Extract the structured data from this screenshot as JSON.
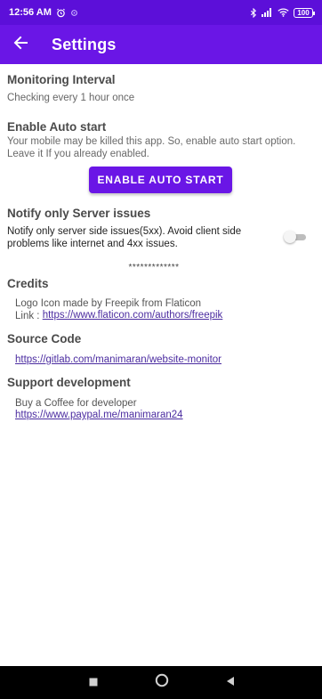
{
  "status_bar": {
    "time": "12:56 AM",
    "icons_left": [
      "alarm-icon",
      "sync-icon"
    ],
    "icons_right": [
      "bluetooth-icon",
      "signal-icon",
      "wifi-icon",
      "battery-icon"
    ],
    "battery": "100"
  },
  "app_bar": {
    "title": "Settings",
    "back_icon": "arrow-back-icon",
    "color": "#6a16e6"
  },
  "monitoring": {
    "title": "Monitoring Interval",
    "value": "Checking every 1 hour once"
  },
  "auto_start": {
    "title": "Enable Auto start",
    "description": "Your mobile may be killed this app. So, enable auto start option. Leave it If you already enabled.",
    "button_label": "ENABLE AUTO START"
  },
  "notify": {
    "title": "Notify only Server issues",
    "description": "Notify only server side issues(5xx). Avoid client side problems like internet and 4xx issues.",
    "switch_on": false
  },
  "separator": "*************",
  "credits": {
    "title": "Credits",
    "line1": "Logo Icon made by Freepik from Flaticon",
    "link_prefix": "Link : ",
    "link": "https://www.flaticon.com/authors/freepik"
  },
  "source_code": {
    "title": "Source Code",
    "link": "https://gitlab.com/manimaran/website-monitor"
  },
  "support": {
    "title": "Support development",
    "line1": "Buy a Coffee for developer",
    "link": "https://www.paypal.me/manimaran24"
  },
  "nav_bar": {
    "buttons": [
      "recents-icon",
      "home-icon",
      "back-icon"
    ]
  },
  "colors": {
    "primary": "#6a16e6",
    "status_bar": "#5c0fd9",
    "link": "#4b2ca0"
  }
}
